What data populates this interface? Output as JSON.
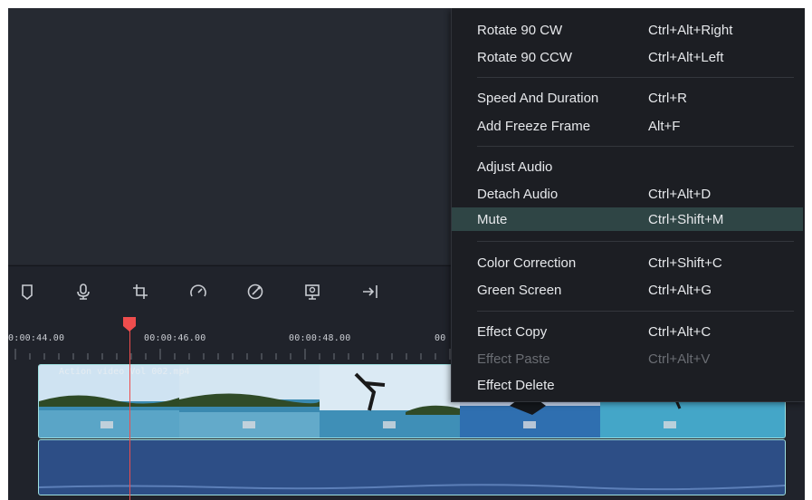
{
  "timeline": {
    "timecodes": [
      "0:00:44.00",
      "00:00:46.00",
      "00:00:48.00",
      "00"
    ],
    "clip_title": "Action video Vol 002.mp4",
    "thumbnail_badges": [
      "01",
      "02",
      "03",
      "04",
      "05"
    ]
  },
  "toolbar": {
    "tools": [
      "marker-icon",
      "microphone-icon",
      "crop-icon",
      "speed-icon",
      "color-icon",
      "snapshot-icon",
      "export-icon"
    ]
  },
  "context_menu": {
    "items": [
      {
        "label": "Rotate 90 CW",
        "shortcut": "Ctrl+Alt+Right"
      },
      {
        "label": "Rotate 90 CCW",
        "shortcut": "Ctrl+Alt+Left"
      },
      {
        "label": "Speed And Duration",
        "shortcut": "Ctrl+R"
      },
      {
        "label": "Add Freeze Frame",
        "shortcut": "Alt+F"
      },
      {
        "label": "Adjust Audio",
        "shortcut": ""
      },
      {
        "label": "Detach Audio",
        "shortcut": "Ctrl+Alt+D"
      },
      {
        "label": "Mute",
        "shortcut": "Ctrl+Shift+M",
        "highlighted": true
      },
      {
        "label": "Color Correction",
        "shortcut": "Ctrl+Shift+C"
      },
      {
        "label": "Green Screen",
        "shortcut": "Ctrl+Alt+G"
      },
      {
        "label": "Effect Copy",
        "shortcut": "Ctrl+Alt+C"
      },
      {
        "label": "Effect Paste",
        "shortcut": "Ctrl+Alt+V",
        "disabled": true
      },
      {
        "label": "Effect Delete",
        "shortcut": ""
      }
    ]
  },
  "colors": {
    "playhead": "#ee4d4d",
    "menu_highlight": "#2f4545",
    "audio_track": "#2d4e86",
    "track_border": "#9fe0e0"
  }
}
